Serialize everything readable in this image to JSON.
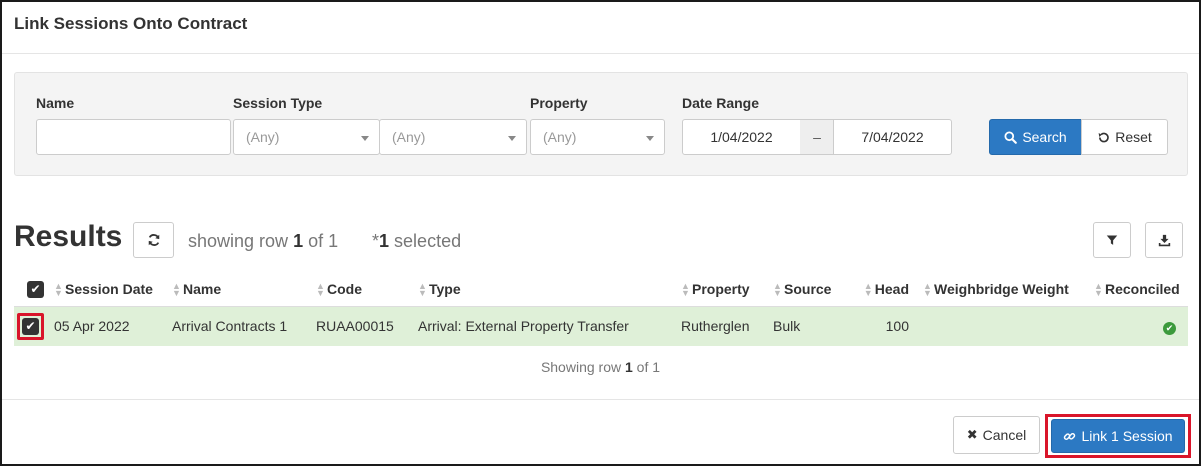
{
  "modal": {
    "title": "Link Sessions Onto Contract"
  },
  "filters": {
    "name_label": "Name",
    "name_value": "",
    "session_type_label": "Session Type",
    "session_type_value": "(Any)",
    "session_subtype_value": "(Any)",
    "property_label": "Property",
    "property_value": "(Any)",
    "date_range_label": "Date Range",
    "date_from": "1/04/2022",
    "date_separator": "–",
    "date_to": "7/04/2022",
    "search_label": "Search",
    "reset_label": "Reset"
  },
  "results": {
    "title": "Results",
    "showing_prefix": "showing row",
    "showing_row": "1",
    "showing_of": "of",
    "showing_total": "1",
    "selected_star": "*",
    "selected_count": "1",
    "selected_label": "selected"
  },
  "table": {
    "columns": [
      "Session Date",
      "Name",
      "Code",
      "Type",
      "Property",
      "Source",
      "Head",
      "Weighbridge Weight",
      "Reconciled"
    ],
    "rows": [
      {
        "checked": true,
        "session_date": "05 Apr 2022",
        "name": "Arrival Contracts 1",
        "code": "RUAA00015",
        "type": "Arrival: External Property Transfer",
        "property": "Rutherglen",
        "source": "Bulk",
        "head": "100",
        "weighbridge_weight": "",
        "reconciled": true
      }
    ]
  },
  "pagination": {
    "prefix": "Showing row",
    "row": "1",
    "of": "of",
    "total": "1"
  },
  "footer": {
    "cancel_label": "Cancel",
    "link_label": "Link 1 Session"
  },
  "colors": {
    "primary": "#2c79c3",
    "selected_row": "#dff0d8",
    "highlight": "#d9152a",
    "success": "#3c9a3c"
  },
  "icons": [
    "search-icon",
    "reset-icon",
    "refresh-icon",
    "filter-icon",
    "download-icon",
    "sort-icon",
    "check-icon",
    "times-icon",
    "link-icon",
    "check-circle-icon"
  ]
}
